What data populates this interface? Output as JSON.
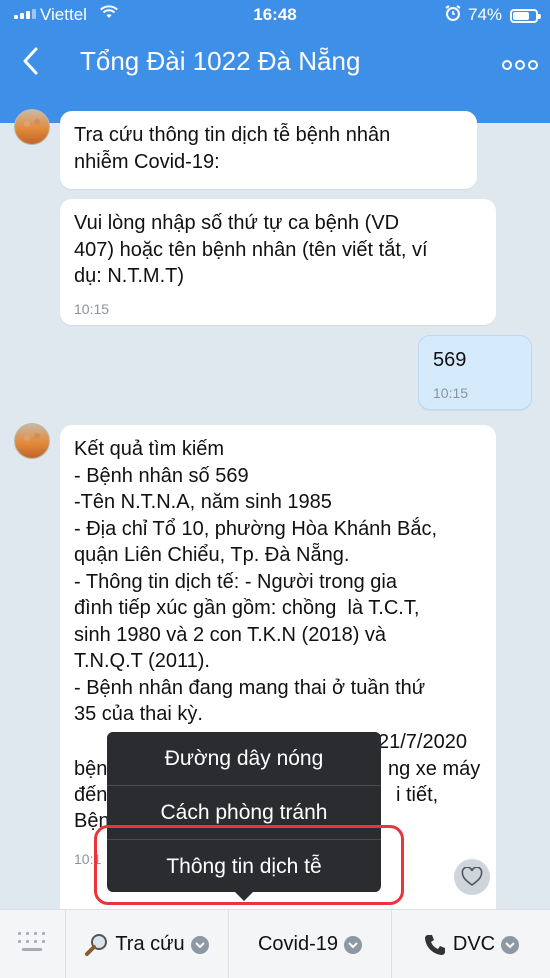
{
  "status_bar": {
    "carrier": "Viettel",
    "time": "16:48",
    "battery_percent": "74%",
    "battery_level": 0.74,
    "wifi_icon": "wifi-icon",
    "alarm_icon": "alarm-icon"
  },
  "header": {
    "title": "Tổng Đài 1022 Đà Nẵng",
    "back_icon": "chevron-left-icon",
    "more_icon": "more-icon",
    "color": "#3d8fe8"
  },
  "messages": {
    "m1": {
      "text": "Tra cứu thông tin dịch tễ bệnh nhân\nnhiễm Covid-19:"
    },
    "m2": {
      "text": "Vui lòng nhập số thứ tự ca bệnh (VD\n407) hoặc tên bệnh nhân (tên viết tắt, ví\ndụ: N.T.M.T)",
      "time": "10:15"
    },
    "m3": {
      "text": "569",
      "time": "10:15"
    },
    "m4": {
      "text": "Kết quả tìm kiếm\n- Bệnh nhân số 569\n-Tên N.T.N.A, năm sinh 1985\n- Địa chỉ Tổ 10, phường Hòa Khánh Bắc,\nquận Liên Chiểu, Tp. Đà Nẵng.\n- Thông tin dịch tế: - Người trong gia\nđình tiếp xúc gần gồm: chồng  là T.C.T,\nsinh 1980 và 2 con T.K.N (2018) và\nT.N.Q.T (2011).\n- Bệnh nhân đang mang thai ở tuần thứ\n35 của thai kỳ.",
      "hidden_partial": {
        "line1_right": "21/7/2020",
        "line2_left": "bện",
        "line2_right": "ng xe máy",
        "line3_left": "đến",
        "line3_right": "i tiết,",
        "line4_left": "Bện"
      },
      "time_partial": "10:1"
    }
  },
  "popup_menu": {
    "options": [
      "Đường dây nóng",
      "Cách phòng tránh",
      "Thông tin dịch tễ"
    ],
    "highlight_color": "#e8343a"
  },
  "bottom_bar": {
    "keyboard_icon": "keyboard-icon",
    "items": [
      {
        "label": "Tra cứu",
        "icon": "search-icon"
      },
      {
        "label": "Covid-19",
        "icon": ""
      },
      {
        "label": "DVC",
        "icon": "phone-icon"
      }
    ]
  }
}
